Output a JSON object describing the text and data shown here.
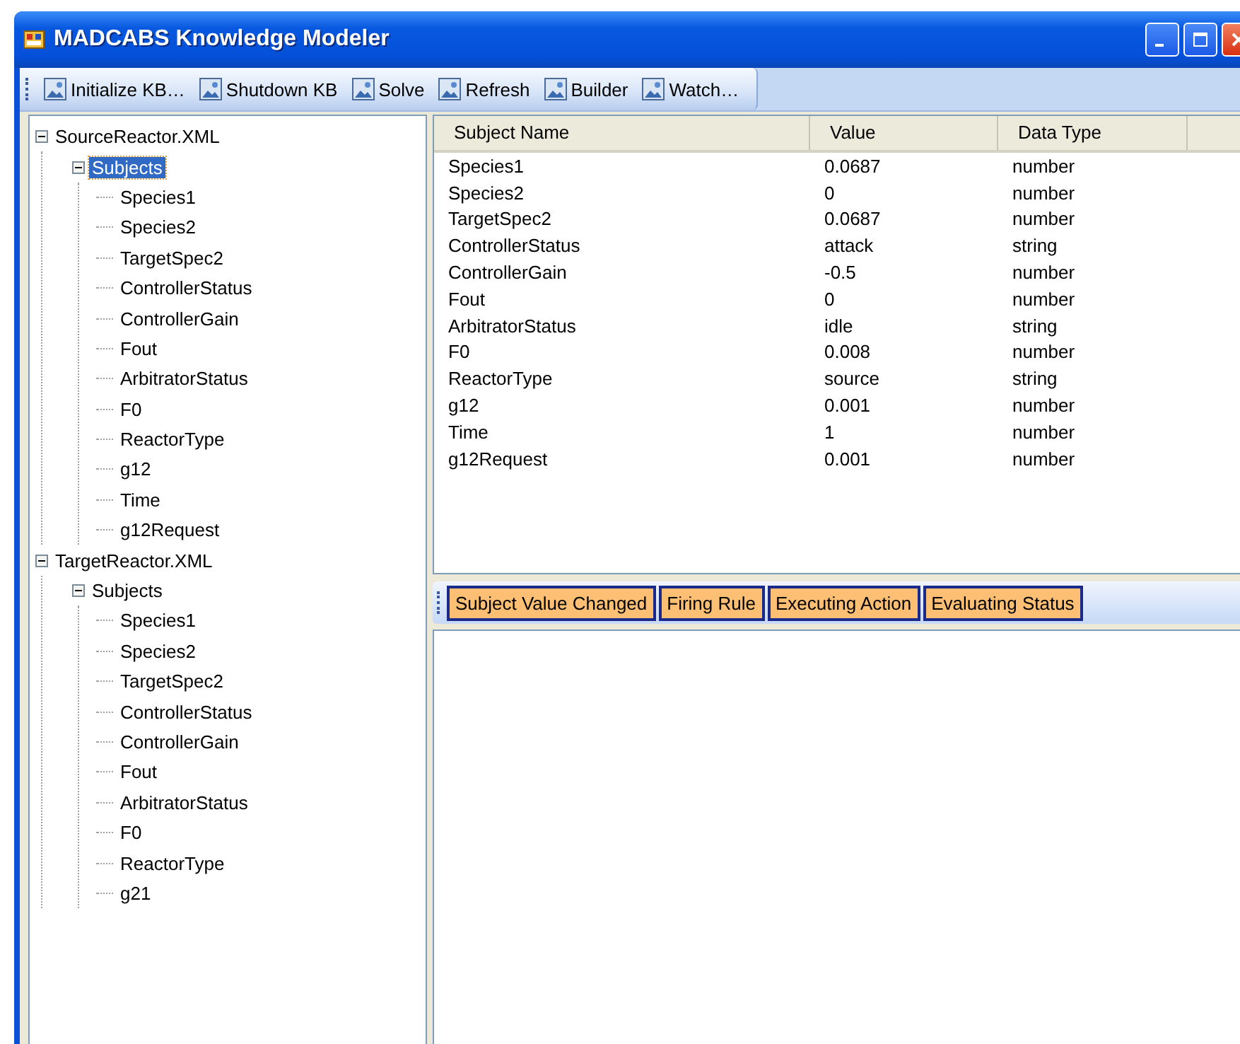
{
  "window": {
    "title": "MADCABS Knowledge Modeler"
  },
  "toolbar": [
    "Initialize KB…",
    "Shutdown KB",
    "Solve",
    "Refresh",
    "Builder",
    "Watch…"
  ],
  "tree": [
    {
      "label": "SourceReactor.XML",
      "expanded": true,
      "selected": false,
      "children": [
        {
          "label": "Subjects",
          "expanded": true,
          "selected": true,
          "children": [
            {
              "label": "Species1",
              "selected": false
            },
            {
              "label": "Species2",
              "selected": false
            },
            {
              "label": "TargetSpec2",
              "selected": false
            },
            {
              "label": "ControllerStatus",
              "selected": false
            },
            {
              "label": "ControllerGain",
              "selected": false
            },
            {
              "label": "Fout",
              "selected": false
            },
            {
              "label": "ArbitratorStatus",
              "selected": false
            },
            {
              "label": "F0",
              "selected": false
            },
            {
              "label": "ReactorType",
              "selected": false
            },
            {
              "label": "g12",
              "selected": false
            },
            {
              "label": "Time",
              "selected": false
            },
            {
              "label": "g12Request",
              "selected": false
            }
          ]
        }
      ]
    },
    {
      "label": "TargetReactor.XML",
      "expanded": true,
      "selected": false,
      "children": [
        {
          "label": "Subjects",
          "expanded": true,
          "selected": false,
          "children": [
            {
              "label": "Species1",
              "selected": false
            },
            {
              "label": "Species2",
              "selected": false
            },
            {
              "label": "TargetSpec2",
              "selected": false
            },
            {
              "label": "ControllerStatus",
              "selected": false
            },
            {
              "label": "ControllerGain",
              "selected": false
            },
            {
              "label": "Fout",
              "selected": false
            },
            {
              "label": "ArbitratorStatus",
              "selected": false
            },
            {
              "label": "F0",
              "selected": false
            },
            {
              "label": "ReactorType",
              "selected": false
            },
            {
              "label": "g21",
              "selected": false
            }
          ]
        }
      ]
    }
  ],
  "table": {
    "columns": [
      "Subject Name",
      "Value",
      "Data Type"
    ],
    "rows": [
      [
        "Species1",
        "0.0687",
        "number"
      ],
      [
        "Species2",
        "0",
        "number"
      ],
      [
        "TargetSpec2",
        "0.0687",
        "number"
      ],
      [
        "ControllerStatus",
        "attack",
        "string"
      ],
      [
        "ControllerGain",
        "-0.5",
        "number"
      ],
      [
        "Fout",
        "0",
        "number"
      ],
      [
        "ArbitratorStatus",
        "idle",
        "string"
      ],
      [
        "F0",
        "0.008",
        "number"
      ],
      [
        "ReactorType",
        "source",
        "string"
      ],
      [
        "g12",
        "0.001",
        "number"
      ],
      [
        "Time",
        "1",
        "number"
      ],
      [
        "g12Request",
        "0.001",
        "number"
      ]
    ]
  },
  "event_toolbar": [
    "Subject Value Changed",
    "Firing Rule",
    "Executing Action",
    "Evaluating Status"
  ]
}
